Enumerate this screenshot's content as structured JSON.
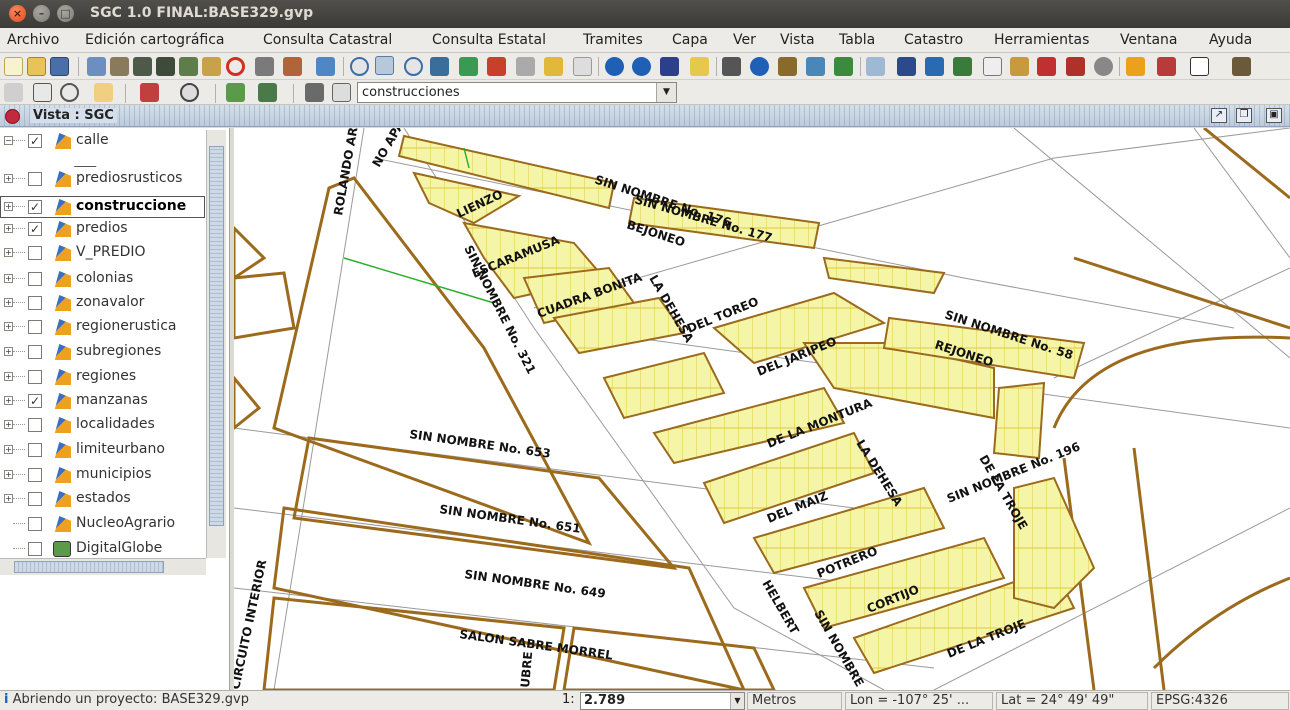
{
  "window": {
    "title": "SGC 1.0 FINAL:BASE329.gvp",
    "close_glyph": "×",
    "min_glyph": "–",
    "max_glyph": "□"
  },
  "menu": [
    "Archivo",
    "Edición cartográfica",
    "Consulta Catastral",
    "Consulta Estatal",
    "Tramites",
    "Capa",
    "Ver",
    "Vista",
    "Tabla",
    "Catastro",
    "Herramientas",
    "Ventana",
    "Ayuda"
  ],
  "toolbar": {
    "layer_combo_value": "construcciones",
    "combo_arrow_glyph": "▼"
  },
  "view": {
    "title": "Vista : SGC"
  },
  "toc": {
    "layers": [
      {
        "name": "calle",
        "checked": true,
        "expander": "−",
        "icon": "line-layer-icon"
      },
      {
        "name": "prediosrusticos",
        "checked": false,
        "expander": "+",
        "icon": "polygon-layer-icon"
      },
      {
        "name": "construccione",
        "checked": true,
        "expander": "+",
        "icon": "polygon-layer-icon",
        "active": true
      },
      {
        "name": "predios",
        "checked": true,
        "expander": "+",
        "icon": "polygon-layer-icon"
      },
      {
        "name": "V_PREDIO",
        "checked": false,
        "expander": "+",
        "icon": "polygon-layer-icon"
      },
      {
        "name": "colonias",
        "checked": false,
        "expander": "+",
        "icon": "polygon-layer-icon"
      },
      {
        "name": "zonavalor",
        "checked": false,
        "expander": "+",
        "icon": "polygon-layer-icon"
      },
      {
        "name": "regionerustica",
        "checked": false,
        "expander": "+",
        "icon": "polygon-layer-icon"
      },
      {
        "name": "subregiones",
        "checked": false,
        "expander": "+",
        "icon": "polygon-layer-icon"
      },
      {
        "name": "regiones",
        "checked": false,
        "expander": "+",
        "icon": "polygon-layer-icon"
      },
      {
        "name": "manzanas",
        "checked": true,
        "expander": "+",
        "icon": "polygon-layer-icon"
      },
      {
        "name": "localidades",
        "checked": false,
        "expander": "+",
        "icon": "polygon-layer-icon"
      },
      {
        "name": "limiteurbano",
        "checked": false,
        "expander": "+",
        "icon": "polygon-layer-icon"
      },
      {
        "name": "municipios",
        "checked": false,
        "expander": "+",
        "icon": "polygon-layer-icon"
      },
      {
        "name": "estados",
        "checked": false,
        "expander": "+",
        "icon": "polygon-layer-icon"
      },
      {
        "name": "NucleoAgrario",
        "checked": false,
        "expander": "",
        "icon": "polygon-layer-icon"
      },
      {
        "name": "DigitalGlobe",
        "checked": false,
        "expander": "",
        "icon": "raster-layer-icon"
      }
    ],
    "check_glyph": "✓"
  },
  "map": {
    "street_labels": [
      "SIN NOMBRE No. 176",
      "SIN NOMBRE No. 177",
      "LIENZO",
      "BEJONEO",
      "ESCARAMUSA",
      "SIN NOMBRE No. 321",
      "LA DEHESA",
      "CUADRA BONITA",
      "DEL TOREO",
      "SIN NOMBRE No. 58",
      "REJONEO",
      "DEL JARIPEO",
      "DE LA MONTURA",
      "LA DEHESA",
      "SIN NOMBRE No. 196",
      "DE LA TROJE",
      "SIN NOMBRE No. 653",
      "DEL MAIZ",
      "SIN NOMBRE No. 651",
      "POTRERO",
      "CORTIJO",
      "SIN NOMBRE No. 649",
      "HELBERT",
      "SIN NOMBRE",
      "DE LA TROJE",
      "SALON SABRE MORREL",
      "ROLANDO ARIC",
      "NO APA",
      "CIRCUITO INTERIOR",
      "UBRE"
    ]
  },
  "status": {
    "message": "Abriendo un proyecto: BASE329.gvp",
    "scale_prefix": "1:",
    "scale": "2.789",
    "units": "Metros",
    "lon": "Lon = -107° 25' ...",
    "lat": "Lat = 24° 49' 49\"",
    "epsg": "EPSG:4326"
  },
  "colors": {
    "title_bg": "#3c3b37",
    "block_outline": "#9b6a1c",
    "parcel_fill": "#f3f39a",
    "parcel_line": "#e0c83a",
    "street_line": "#8a8a8a",
    "selection": "#c02a3c"
  }
}
